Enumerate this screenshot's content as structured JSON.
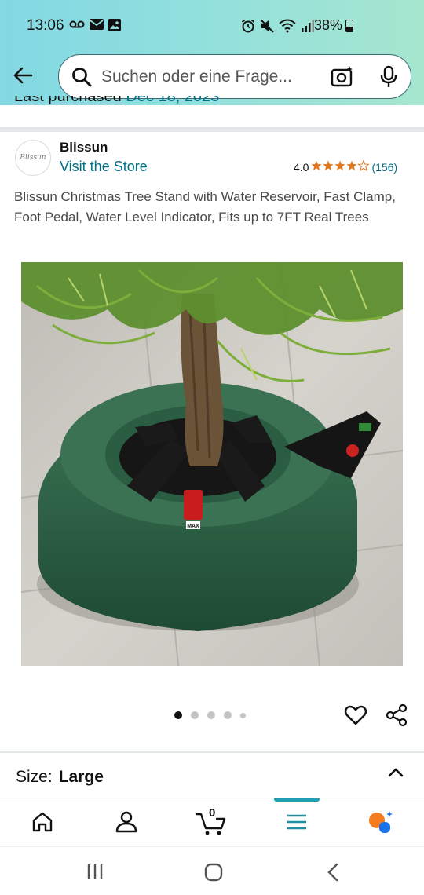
{
  "status_bar": {
    "time": "13:06",
    "battery_text": "38%",
    "left_icons": [
      "voicemail-icon",
      "mail-icon",
      "gallery-icon"
    ],
    "right_icons": [
      "alarm-icon",
      "mute-icon",
      "wifi-icon",
      "signal-icon",
      "battery-icon"
    ]
  },
  "header": {
    "search_placeholder": "Suchen oder eine Frage...",
    "icons": [
      "back-arrow-icon",
      "search-icon",
      "camera-icon",
      "mic-icon"
    ],
    "accent": "#8fdedf"
  },
  "last_purchased": {
    "label": "Last purchased",
    "date": "Dec 18, 2023"
  },
  "brand": {
    "logo_text": "Blissun",
    "name": "Blissun",
    "visit_link": "Visit the Store",
    "rating_value": "4.0",
    "rating_stars": 4,
    "rating_count": "(156)",
    "star_color": "#de7921"
  },
  "product": {
    "title": "Blissun Christmas Tree Stand with Water Reservoir, Fast Clamp, Foot Pedal, Water Level Indicator, Fits up to 7FT Real Trees",
    "image_label": "MAX",
    "image_count": 5,
    "active_image": 1
  },
  "options": {
    "size_label": "Size:",
    "size_value": "Large"
  },
  "bottom_nav": {
    "items": [
      "home-icon",
      "account-icon",
      "cart-icon",
      "menu-icon",
      "rufus-icon"
    ],
    "cart_count": "0",
    "active": "menu-icon",
    "active_color": "#1da0b1"
  },
  "system_nav": {
    "items": [
      "recent-apps-icon",
      "home-circle-icon",
      "back-chevron-icon"
    ]
  }
}
